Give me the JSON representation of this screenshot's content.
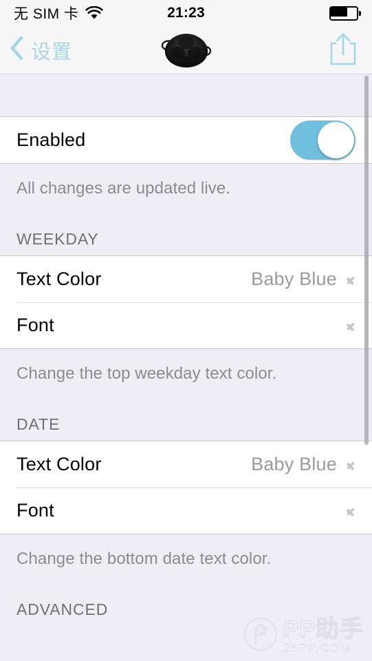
{
  "status_bar": {
    "carrier": "无 SIM 卡",
    "wifi_icon": "wifi-icon",
    "time": "21:23",
    "battery_icon": "battery-icon",
    "battery_level_percent": 62
  },
  "nav_bar": {
    "back_label": "设置",
    "back_icon": "chevron-left-icon",
    "title_icon": "app-logo-icon",
    "share_icon": "share-icon",
    "tint_color": "#a9d7ea"
  },
  "settings": {
    "enabled_row": {
      "label": "Enabled",
      "toggle_on": true,
      "toggle_on_color": "#72c0e0"
    },
    "enabled_footer": "All changes are updated live.",
    "sections": [
      {
        "header": "WEEKDAY",
        "rows": [
          {
            "label": "Text Color",
            "value": "Baby Blue",
            "accessory": "chevron-right-icon"
          },
          {
            "label": "Font",
            "value": "",
            "accessory": "chevron-right-icon"
          }
        ],
        "footer": "Change the top weekday text color."
      },
      {
        "header": "DATE",
        "rows": [
          {
            "label": "Text Color",
            "value": "Baby Blue",
            "accessory": "chevron-right-icon"
          },
          {
            "label": "Font",
            "value": "",
            "accessory": "chevron-right-icon"
          }
        ],
        "footer": "Change the bottom date text color."
      },
      {
        "header": "ADVANCED",
        "rows": [],
        "footer": ""
      }
    ]
  },
  "watermark": {
    "main": "PP助手",
    "sub": "25PP.COM",
    "logo_icon": "pp-logo-icon"
  },
  "colors": {
    "background": "#efeef4",
    "cell_background": "#ffffff",
    "separator": "#c8c7cc",
    "value_text": "#9a9a9f",
    "footer_text": "#8b8b91",
    "header_text": "#6f6f76"
  }
}
